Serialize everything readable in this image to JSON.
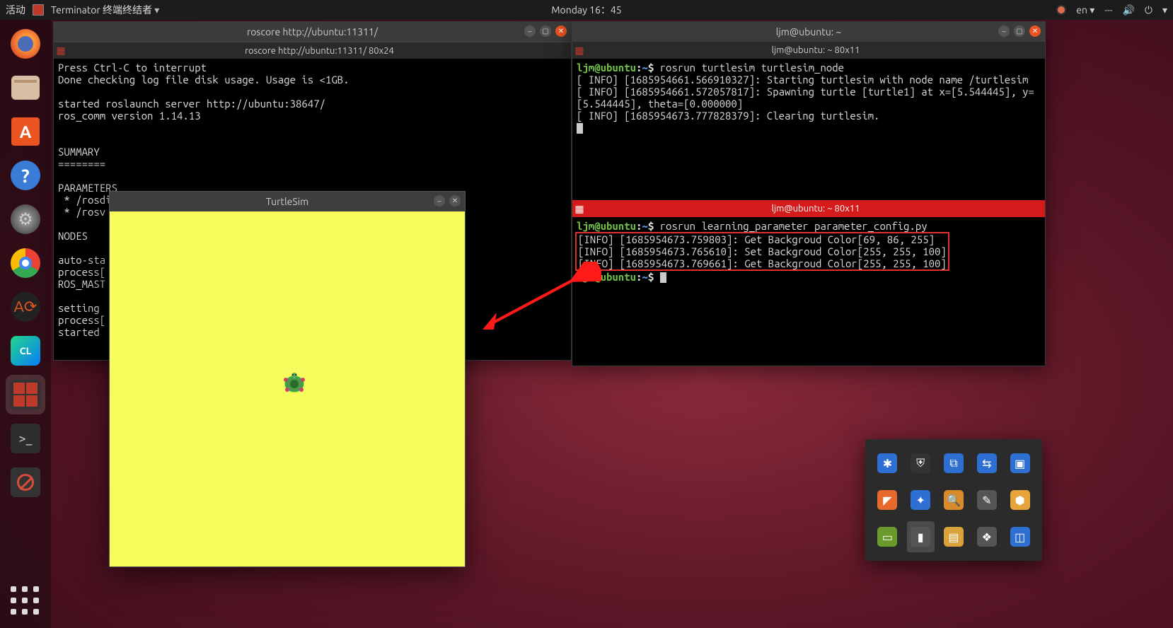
{
  "topbar": {
    "activities": "活动",
    "app_name": "Terminator 终端终结者",
    "clock": "Monday 16：45",
    "lang": "en",
    "lang_arrow": "▾"
  },
  "dock": {
    "items": [
      {
        "name": "firefox"
      },
      {
        "name": "files"
      },
      {
        "name": "software",
        "label": "A"
      },
      {
        "name": "help",
        "label": "?"
      },
      {
        "name": "settings",
        "label": "⚙"
      },
      {
        "name": "chrome"
      },
      {
        "name": "updater",
        "label": "A⟳"
      },
      {
        "name": "clion",
        "label": "CL"
      },
      {
        "name": "terminator",
        "active": true
      },
      {
        "name": "terminal",
        "label": ">_"
      },
      {
        "name": "blocked"
      }
    ]
  },
  "win_left": {
    "title": "roscore http://ubuntu:11311/",
    "tab": "roscore http://ubuntu:11311/ 80x24",
    "body": "Press Ctrl-C to interrupt\nDone checking log file disk usage. Usage is <1GB.\n\nstarted roslaunch server http://ubuntu:38647/\nros_comm version 1.14.13\n\n\nSUMMARY\n========\n\nPARAMETERS\n * /rosdi\n * /rosv\n\nNODES\n\nauto-sta\nprocess[\nROS_MAST\n\nsetting \nprocess[\nstarted "
  },
  "win_right": {
    "title": "ljm@ubuntu: ~",
    "pane1": {
      "tab": "ljm@ubuntu: ~ 80x11",
      "prompt_user": "ljm@ubuntu",
      "prompt_path": "~",
      "cmd": "rosrun turtlesim turtlesim_node",
      "lines": "[ INFO] [1685954661.566910327]: Starting turtlesim with node name /turtlesim\n[ INFO] [1685954661.572057817]: Spawning turtle [turtle1] at x=[5.544445], y=[5.544445], theta=[0.000000]\n[ INFO] [1685954673.777828379]: Clearing turtlesim."
    },
    "pane2": {
      "tab": "ljm@ubuntu: ~ 80x11",
      "prompt_user": "ljm@ubuntu",
      "prompt_path": "~",
      "cmd": "rosrun learning_parameter parameter_config.py",
      "box": "[INFO] [1685954673.759803]: Get Backgroud Color[69, 86, 255]\n[INFO] [1685954673.765610]: Set Backgroud Color[255, 255, 100]\n[INFO] [1685954673.769661]: Get Backgroud Color[255, 255, 100]",
      "prompt2_user": "ljm@ubuntu",
      "prompt2_path": "~"
    }
  },
  "turtlesim": {
    "title": "TurtleSim",
    "bg": "#f8fb5c"
  },
  "tray_icons": [
    {
      "bg": "#2d6fd2",
      "g": "✱"
    },
    {
      "bg": "#333",
      "g": "⛨"
    },
    {
      "bg": "#2d6fd2",
      "g": "⧉"
    },
    {
      "bg": "#2d6fd2",
      "g": "⇆"
    },
    {
      "bg": "#2d6fd2",
      "g": "▣"
    },
    {
      "bg": "#e66a2c",
      "g": "◤"
    },
    {
      "bg": "#2d6fd2",
      "g": "✦"
    },
    {
      "bg": "#d98a2b",
      "g": "🔍"
    },
    {
      "bg": "#555",
      "g": "✎"
    },
    {
      "bg": "#e6a43a",
      "g": "⬢"
    },
    {
      "bg": "#6a9a2b",
      "g": "▭"
    },
    {
      "bg": "#555",
      "g": "▮",
      "active": true
    },
    {
      "bg": "#d9a23a",
      "g": "▤"
    },
    {
      "bg": "#555",
      "g": "❖"
    },
    {
      "bg": "#2d6fd2",
      "g": "◫"
    }
  ]
}
